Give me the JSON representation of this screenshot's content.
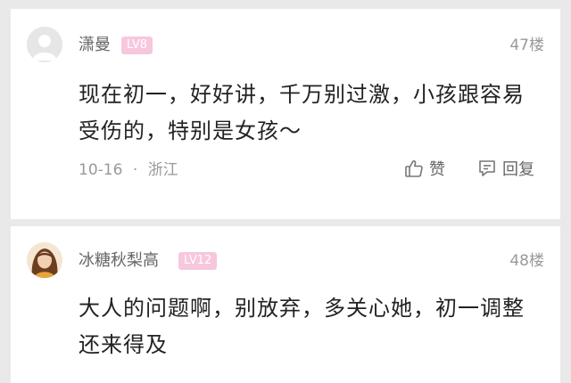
{
  "comments": [
    {
      "username": "潇曼",
      "level": "LV8",
      "floor": "47楼",
      "content": "现在初一，好好讲，千万别过激，小孩跟容易受伤的，特别是女孩～",
      "date": "10-16",
      "separator": "·",
      "location": "浙江",
      "like_label": "赞",
      "reply_label": "回复",
      "avatar_icon": "default-avatar-icon"
    },
    {
      "username": "冰糖秋梨高",
      "level": "LV12",
      "floor": "48楼",
      "content": "大人的问题啊，别放弃，多关心她，初一调整还来得及",
      "avatar_icon": "user-photo-avatar"
    }
  ],
  "colors": {
    "background": "#e9e9e9",
    "card": "#ffffff",
    "level_badge": "#f7c7de",
    "username": "#666666",
    "content": "#222222",
    "meta": "#999999"
  }
}
